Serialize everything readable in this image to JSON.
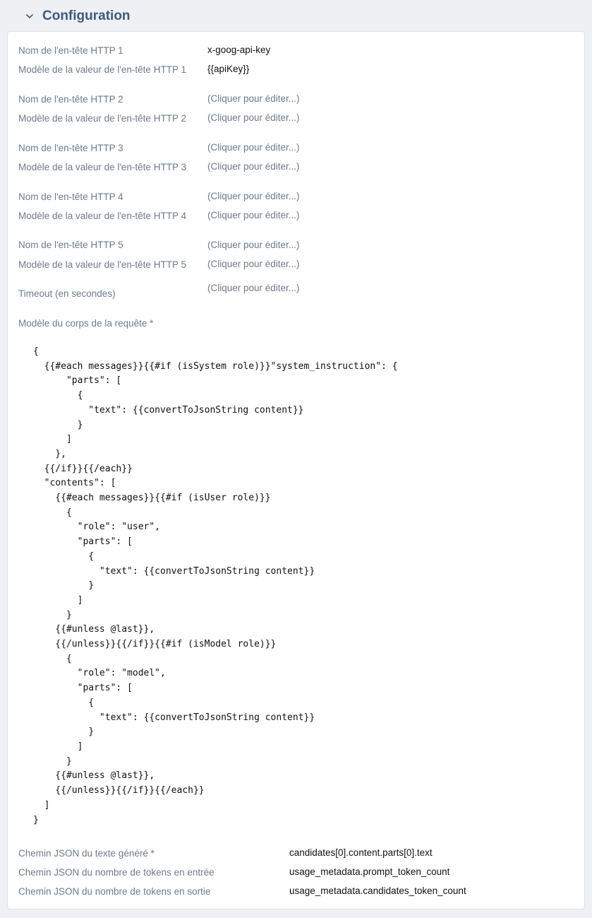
{
  "section": {
    "title": "Configuration"
  },
  "fields": {
    "h1_name_label": "Nom de l'en-tête HTTP 1",
    "h1_name_value": "x-goog-api-key",
    "h1_value_label": "Modèle de la valeur de l'en-tête HTTP 1",
    "h1_value_value": "{{apiKey}}",
    "h2_name_label": "Nom de l'en-tête HTTP 2",
    "h2_value_label": "Modèle de la valeur de l'en-tête HTTP 2",
    "h3_name_label": "Nom de l'en-tête HTTP 3",
    "h3_value_label": "Modèle de la valeur de l'en-tête HTTP 3",
    "h4_name_label": "Nom de l'en-tête HTTP 4",
    "h4_value_label": "Modèle de la valeur de l'en-tête HTTP 4",
    "h5_name_label": "Nom de l'en-tête HTTP 5",
    "h5_value_label": "Modèle de la valeur de l'en-tête HTTP 5",
    "timeout_label": "Timeout (en secondes)",
    "placeholder": "(Cliquer pour éditer...)",
    "body_label": "Modèle du corps de la requête *",
    "body_template": "{\n  {{#each messages}}{{#if (isSystem role)}}\"system_instruction\": {\n      \"parts\": [\n        {\n          \"text\": {{convertToJsonString content}}\n        }\n      ]\n    },\n  {{/if}}{{/each}}\n  \"contents\": [\n    {{#each messages}}{{#if (isUser role)}}\n      {\n        \"role\": \"user\",\n        \"parts\": [\n          {\n            \"text\": {{convertToJsonString content}}\n          }\n        ]\n      }\n    {{#unless @last}},\n    {{/unless}}{{/if}}{{#if (isModel role)}}\n      {\n        \"role\": \"model\",\n        \"parts\": [\n          {\n            \"text\": {{convertToJsonString content}}\n          }\n        ]\n      }\n    {{#unless @last}},\n    {{/unless}}{{/if}}{{/each}}\n  ]\n}",
    "json_text_label": "Chemin JSON du texte généré *",
    "json_text_value": "candidates[0].content.parts[0].text",
    "json_in_label": "Chemin JSON du nombre de tokens en entrée",
    "json_in_value": "usage_metadata.prompt_token_count",
    "json_out_label": "Chemin JSON du nombre de tokens en sortie",
    "json_out_value": "usage_metadata.candidates_token_count"
  },
  "icons": {
    "collapse": "chevron-down-icon"
  },
  "colors": {
    "title": "#3e5a7e",
    "label": "#6e7a8b",
    "value": "#111111",
    "background": "#eef0f4"
  }
}
